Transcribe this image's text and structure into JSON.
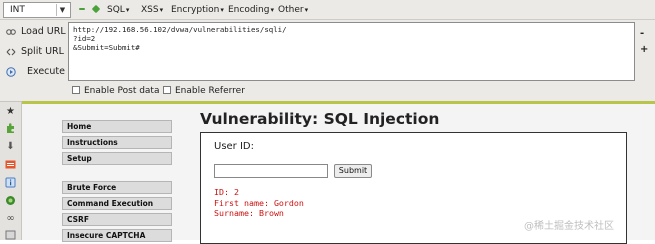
{
  "hackbar": {
    "type_select": "INT",
    "menus": [
      "SQL",
      "XSS",
      "Encryption",
      "Encoding",
      "Other"
    ],
    "actions": {
      "load_url": "Load URL",
      "split_url": "Split URL",
      "execute": "Execute"
    },
    "url_lines": [
      "http://192.168.56.102/dvwa/vulnerabilities/sqli/",
      "?id=2",
      "&Submit=Submit#"
    ],
    "side_buttons": [
      "-",
      "+"
    ],
    "options": {
      "enable_post": "Enable Post data",
      "enable_referrer": "Enable Referrer"
    }
  },
  "dvwa": {
    "nav": {
      "group1": [
        "Home",
        "Instructions",
        "Setup"
      ],
      "group2": [
        "Brute Force",
        "Command Execution",
        "CSRF",
        "Insecure CAPTCHA"
      ]
    },
    "title": "Vulnerability: SQL Injection",
    "form": {
      "label": "User ID:",
      "input_value": "",
      "submit": "Submit"
    },
    "result": {
      "id": "ID: 2",
      "first_name": "First name: Gordon",
      "surname": "Surname: Brown"
    }
  },
  "watermark": "@稀土掘金技术社区",
  "colors": {
    "accent_bar": "#b8c54a",
    "result_text": "#cc1111",
    "green_dot": "#49a23a"
  }
}
